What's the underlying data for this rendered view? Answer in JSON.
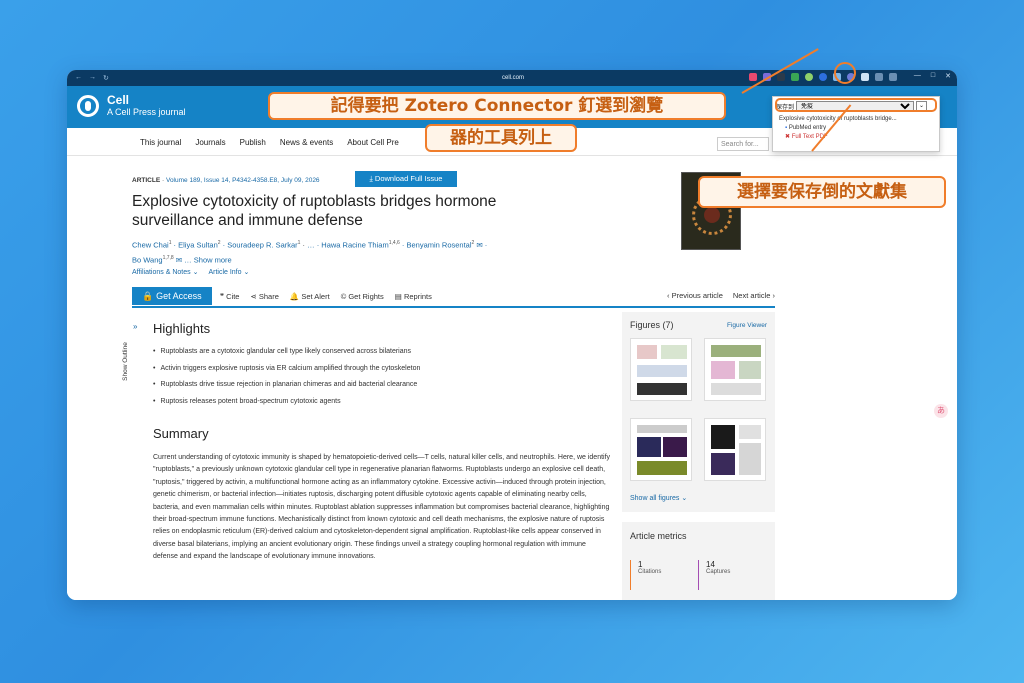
{
  "browser": {
    "url": "cell.com",
    "nav_back": "←",
    "nav_forward": "→",
    "nav_reload": "↻"
  },
  "site": {
    "brand": "Cell",
    "tagline": "A Cell Press journal",
    "nav": [
      "This journal",
      "Journals",
      "Publish",
      "News & events",
      "About Cell Pre"
    ],
    "search_placeholder": "Search for..."
  },
  "zotero_popup": {
    "save_to_label": "保存到",
    "collection": "免疫",
    "items": [
      "Explosive cytotoxicity of ruptoblasts bridge...",
      "PubMed entry",
      "Full Text PDF"
    ]
  },
  "annotations": {
    "pin_extension": "記得要把 Zotero Connector 釘選到瀏覽",
    "pin_extension_2": "器的工具列上",
    "choose_collection": "選擇要保存倒的文獻集"
  },
  "article": {
    "type": "ARTICLE",
    "meta": "Volume 189, Issue 14, P4342-4358.E8, July 09, 2026",
    "download": "Download Full Issue",
    "title": "Explosive cytotoxicity of ruptoblasts bridges hormone surveillance and immune defense",
    "authors": [
      {
        "name": "Chew Chai",
        "sup": "1"
      },
      {
        "name": "Eliya Sultan",
        "sup": "2"
      },
      {
        "name": "Souradeep R. Sarkar",
        "sup": "1"
      },
      {
        "name": "Hawa Racine Thiam",
        "sup": "1,4,6"
      },
      {
        "name": "Benyamin Rosental",
        "sup": "2"
      },
      {
        "name": "Bo Wang",
        "sup": "1,7,8"
      }
    ],
    "show_more": "Show more",
    "affiliations": "Affiliations & Notes",
    "article_info": "Article Info"
  },
  "toolbar": {
    "get_access": "Get Access",
    "cite": "Cite",
    "share": "Share",
    "set_alert": "Set Alert",
    "get_rights": "Get Rights",
    "reprints": "Reprints",
    "previous": "Previous article",
    "next": "Next article"
  },
  "outline": {
    "label": "Show Outline"
  },
  "highlights": {
    "title": "Highlights",
    "items": [
      "Ruptoblasts are a cytotoxic glandular cell type likely conserved across bilaterians",
      "Activin triggers explosive ruptosis via ER calcium amplified through the cytoskeleton",
      "Ruptoblasts drive tissue rejection in planarian chimeras and aid bacterial clearance",
      "Ruptosis releases potent broad-spectrum cytotoxic agents"
    ]
  },
  "summary": {
    "title": "Summary",
    "text": "Current understanding of cytotoxic immunity is shaped by hematopoietic-derived cells—T cells, natural killer cells, and neutrophils. Here, we identify \"ruptoblasts,\" a previously unknown cytotoxic glandular cell type in regenerative planarian flatworms. Ruptoblasts undergo an explosive cell death, \"ruptosis,\" triggered by activin, a multifunctional hormone acting as an inflammatory cytokine. Excessive activin—induced through protein injection, genetic chimerism, or bacterial infection—initiates ruptosis, discharging potent diffusible cytotoxic agents capable of eliminating nearby cells, bacteria, and even mammalian cells within minutes. Ruptoblast ablation suppresses inflammation but compromises bacterial clearance, highlighting their broad-spectrum immune functions. Mechanistically distinct from known cytotoxic and cell death mechanisms, the explosive nature of ruptosis relies on endoplasmic reticulum (ER)-derived calcium and cytoskeleton-dependent signal amplification. Ruptoblast-like cells appear conserved in diverse basal bilaterians, implying an ancient evolutionary origin. These findings unveil a strategy coupling hormonal regulation with immune defense and expand the landscape of evolutionary immune innovations."
  },
  "figures": {
    "title": "Figures (7)",
    "viewer": "Figure Viewer",
    "show_all": "Show all figures"
  },
  "metrics": {
    "title": "Article metrics",
    "citations_value": "1",
    "citations_label": "Citations",
    "captures_value": "14",
    "captures_label": "Captures"
  },
  "colors": {
    "accent": "#1583c6",
    "annotation": "#f07d2b",
    "annotation_text": "#c65f12"
  }
}
